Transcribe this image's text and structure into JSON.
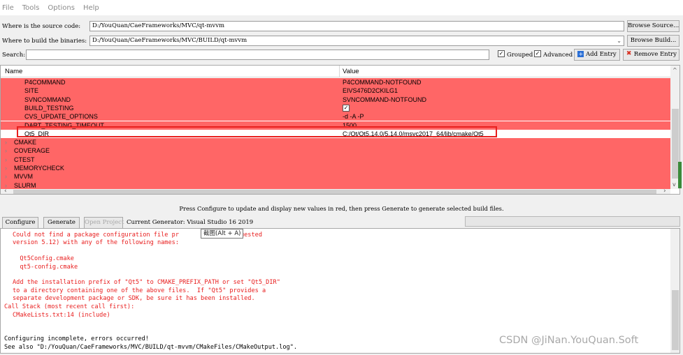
{
  "menu": {
    "items": [
      "File",
      "Tools",
      "Options",
      "Help"
    ]
  },
  "source_row": {
    "label": "Where is the source code:",
    "value": "D:/YouQuan/CaeFrameworks/MVC/qt-mvvm",
    "button": "Browse Source..."
  },
  "build_row": {
    "label": "Where to build the binaries:",
    "value": "D:/YouQuan/CaeFrameworks/MVC/BUILD/qt-mvvm",
    "button": "Browse Build..."
  },
  "search_row": {
    "label": "Search:",
    "value": "",
    "grouped_label": "Grouped",
    "grouped_checked": true,
    "advanced_label": "Advanced",
    "advanced_checked": true,
    "add_entry": "Add Entry",
    "remove_entry": "Remove Entry"
  },
  "tree": {
    "columns": {
      "name": "Name",
      "value": "Value"
    },
    "rows": [
      {
        "name": "P4COMMAND",
        "value": "P4COMMAND-NOTFOUND",
        "style": "red",
        "kind": "entry"
      },
      {
        "name": "SITE",
        "value": "EIVS476D2CKILG1",
        "style": "red",
        "kind": "entry"
      },
      {
        "name": "SVNCOMMAND",
        "value": "SVNCOMMAND-NOTFOUND",
        "style": "red",
        "kind": "entry"
      },
      {
        "name": "BUILD_TESTING",
        "value": "",
        "checked": true,
        "style": "red",
        "kind": "entry"
      },
      {
        "name": "CVS_UPDATE_OPTIONS",
        "value": "-d -A -P",
        "style": "red",
        "kind": "entry"
      },
      {
        "name": "DART_TESTING_TIMEOUT",
        "value": "1500",
        "style": "red",
        "kind": "entry"
      },
      {
        "name": "Qt5_DIR",
        "value": "C:/Qt/Qt5.14.0/5.14.0/msvc2017_64/lib/cmake/Qt5",
        "style": "white",
        "kind": "entry"
      },
      {
        "name": "CMAKE",
        "value": "",
        "style": "red",
        "kind": "group"
      },
      {
        "name": "COVERAGE",
        "value": "",
        "style": "red",
        "kind": "group"
      },
      {
        "name": "CTEST",
        "value": "",
        "style": "red",
        "kind": "group"
      },
      {
        "name": "MEMORYCHECK",
        "value": "",
        "style": "red",
        "kind": "group"
      },
      {
        "name": "MVVM",
        "value": "",
        "style": "red",
        "kind": "group"
      },
      {
        "name": "SLURM",
        "value": "",
        "style": "red",
        "kind": "group"
      }
    ]
  },
  "status_text": "Press Configure to update and display new values in red, then press Generate to generate selected build files.",
  "actions": {
    "configure": "Configure",
    "generate": "Generate",
    "open_project": "Open Project",
    "generator_label": "Current Generator: Visual Studio 16 2019"
  },
  "tooltip": "截图(Alt + A)",
  "output": {
    "red_block_1": "Could not find a package configuration file pr        Qt5\" (requested\nversion 5.12) with any of the following names:\n\n  Qt5Config.cmake\n  qt5-config.cmake\n\nAdd the installation prefix of \"Qt5\" to CMAKE_PREFIX_PATH or set \"Qt5_DIR\"\nto a directory containing one of the above files.  If \"Qt5\" provides a\nseparate development package or SDK, be sure it has been installed.",
    "call_stack_header": "Call Stack (most recent call first):",
    "call_stack_line": "CMakeLists.txt:14 (include)",
    "configuring_incomplete": "Configuring incomplete, errors occurred!",
    "see_also": "See also \"D:/YouQuan/CaeFrameworks/MVC/BUILD/qt-mvvm/CMakeFiles/CMakeOutput.log\"."
  },
  "watermark": "CSDN @JiNan.YouQuan.Soft",
  "colors": {
    "red_row": "#ff6666",
    "error_text": "#e81c1c",
    "highlight": "#e8201e"
  }
}
